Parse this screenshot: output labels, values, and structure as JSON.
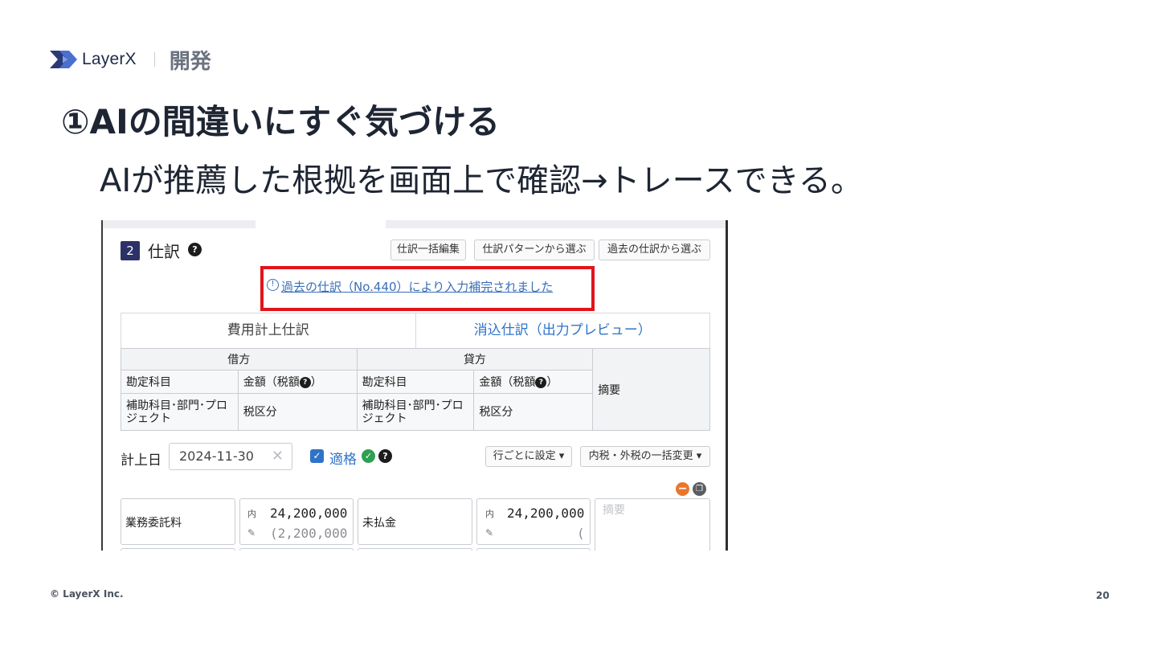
{
  "header": {
    "brand_name": "LayerX",
    "section": "開発"
  },
  "slide": {
    "title": "①AIの間違いにすぐ気づける",
    "subtitle": "AIが推薦した根拠を画面上で確認→トレースできる。"
  },
  "app": {
    "step_number": "2",
    "step_title": "仕訳",
    "toolbar": {
      "bulk_edit": "仕訳一括編集",
      "pattern_select": "仕訳パターンから選ぶ",
      "past_select": "過去の仕訳から選ぶ"
    },
    "notice": "過去の仕訳（No.440）により入力補完されました",
    "tabs": {
      "expense": "費用計上仕訳",
      "clearing": "消込仕訳（出力プレビュー）"
    },
    "table": {
      "debit": "借方",
      "credit": "貸方",
      "account": "勘定科目",
      "amount": "金額（税額",
      "amount_close": "）",
      "sub_account": "補助科目･部門･プロジェクト",
      "tax_category": "税区分",
      "memo": "摘要"
    },
    "date_label": "計上日",
    "date_value": "2024-11-30",
    "valid_label": "適格",
    "row_setting": "行ごとに設定",
    "tax_bulk_change": "内税・外税の一括変更",
    "entry": {
      "debit_account": "業務委託料",
      "tax_mark": "内",
      "debit_amount": "24,200,000",
      "debit_tax": "(2,200,000",
      "credit_account": "未払金",
      "credit_amount": "24,200,000",
      "credit_tax": "(",
      "memo_placeholder": "摘要"
    }
  },
  "footer": {
    "copyright": "© LayerX Inc.",
    "page": "20"
  },
  "colors": {
    "accent_blue": "#2f73c9",
    "highlight_red": "#e0151b",
    "badge_navy": "#2c3267"
  }
}
